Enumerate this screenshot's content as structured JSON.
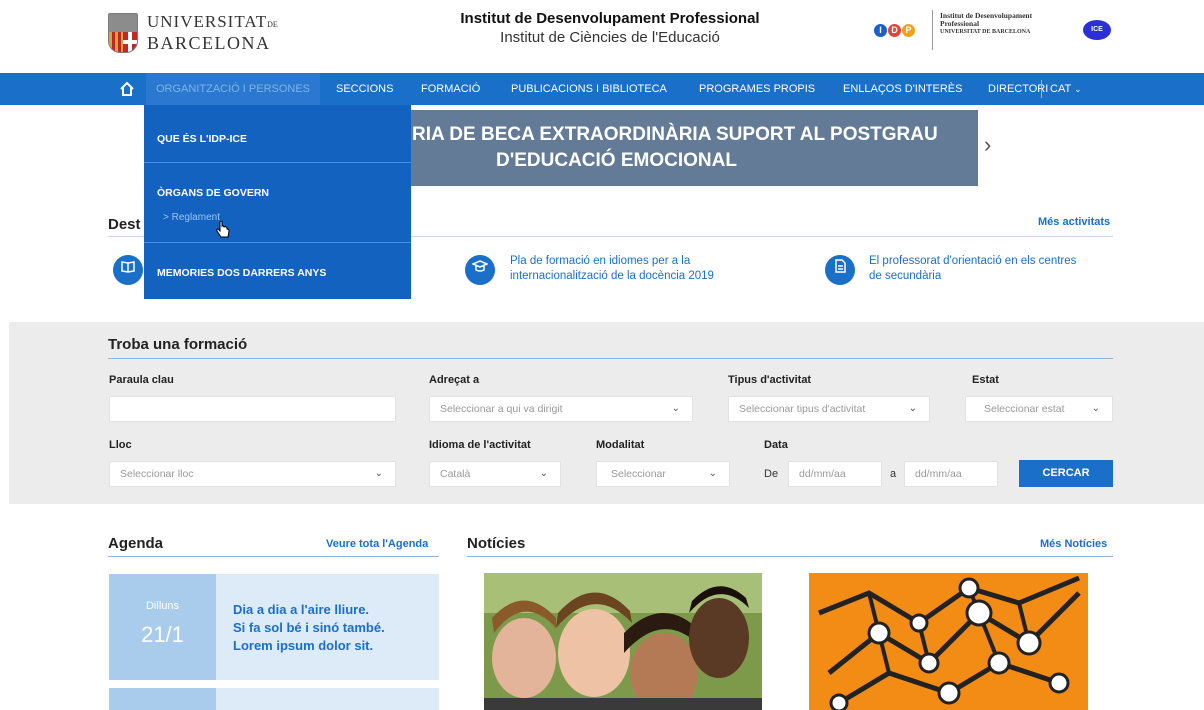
{
  "header": {
    "ub_logo_line1_main": "UNIVERSITAT",
    "ub_logo_line1_small": "DE",
    "ub_logo_line2": "BARCELONA",
    "title": "Institut de Desenvolupament Professional",
    "subtitle": "Institut de Ciències de l'Educació",
    "idp_letters": [
      "I",
      "D",
      "P"
    ],
    "idp_colors": [
      "#1a5fd0",
      "#e0463a",
      "#f2a11a"
    ],
    "idp_text_line1": "Institut de Desenvolupament",
    "idp_text_line2": "Professional",
    "idp_text_line3": "UNIVERSITAT DE BARCELONA",
    "ice_badge": "ICE"
  },
  "nav": {
    "home_icon": "home-icon",
    "items": [
      "ORGANITZACIÓ I PERSONES",
      "SECCIONS",
      "FORMACIÓ",
      "PUBLICACIONS I BIBLIOTECA",
      "PROGRAMES PROPIS",
      "ENLLAÇOS D'INTERÈS",
      "DIRECTORI"
    ],
    "language": "CAT"
  },
  "dropdown": {
    "item1": "QUE ÉS L'IDP-ICE",
    "item2": "ÒRGANS DE GOVERN",
    "sub1": "> Reglament",
    "item3": "MEMORIES DOS DARRERS ANYS"
  },
  "banner": {
    "line1": "RIA DE BECA EXTRAORDINÀRIA SUPORT AL POSTGRAU",
    "line2": "D'EDUCACIÓ EMOCIONAL"
  },
  "destacats": {
    "title": "Dest",
    "more": "Més activitats",
    "items": [
      {
        "icon": "book-icon",
        "text": ""
      },
      {
        "icon": "graduation-cap-icon",
        "line1": "Pla de formació en idiomes per a la",
        "line2": "internacionalització de la docència 2019"
      },
      {
        "icon": "document-icon",
        "line1": "El professorat d'orientació en els centres",
        "line2": "de secundària"
      }
    ]
  },
  "search": {
    "title": "Troba una formació",
    "keyword_label": "Paraula clau",
    "keyword_value": "",
    "adrecat_label": "Adreçat a",
    "adrecat_placeholder": "Seleccionar a qui va dirigit",
    "tipus_label": "Tipus d'activitat",
    "tipus_placeholder": "Seleccionar tipus d'activitat",
    "estat_label": "Estat",
    "estat_placeholder": "Seleccionar estat",
    "lloc_label": "Lloc",
    "lloc_placeholder": "Seleccionar lloc",
    "idioma_label": "Idioma de l'activitat",
    "idioma_value": "Català",
    "modalitat_label": "Modalitat",
    "modalitat_placeholder": "Seleccionar",
    "data_label": "Data",
    "de_label": "De",
    "a_label": "a",
    "date_placeholder": "dd/mm/aa",
    "button": "CERCAR"
  },
  "agenda": {
    "title": "Agenda",
    "link": "Veure tota l'Agenda",
    "day_name": "Dilluns",
    "day_num": "21/1",
    "event_line1": "Dia a dia a l'aire lliure.",
    "event_line2": "Si fa sol bé i sinó també.",
    "event_line3": "Lorem ipsum dolor sit."
  },
  "noticies": {
    "title": "Notícies",
    "link": "Més Notícies"
  }
}
